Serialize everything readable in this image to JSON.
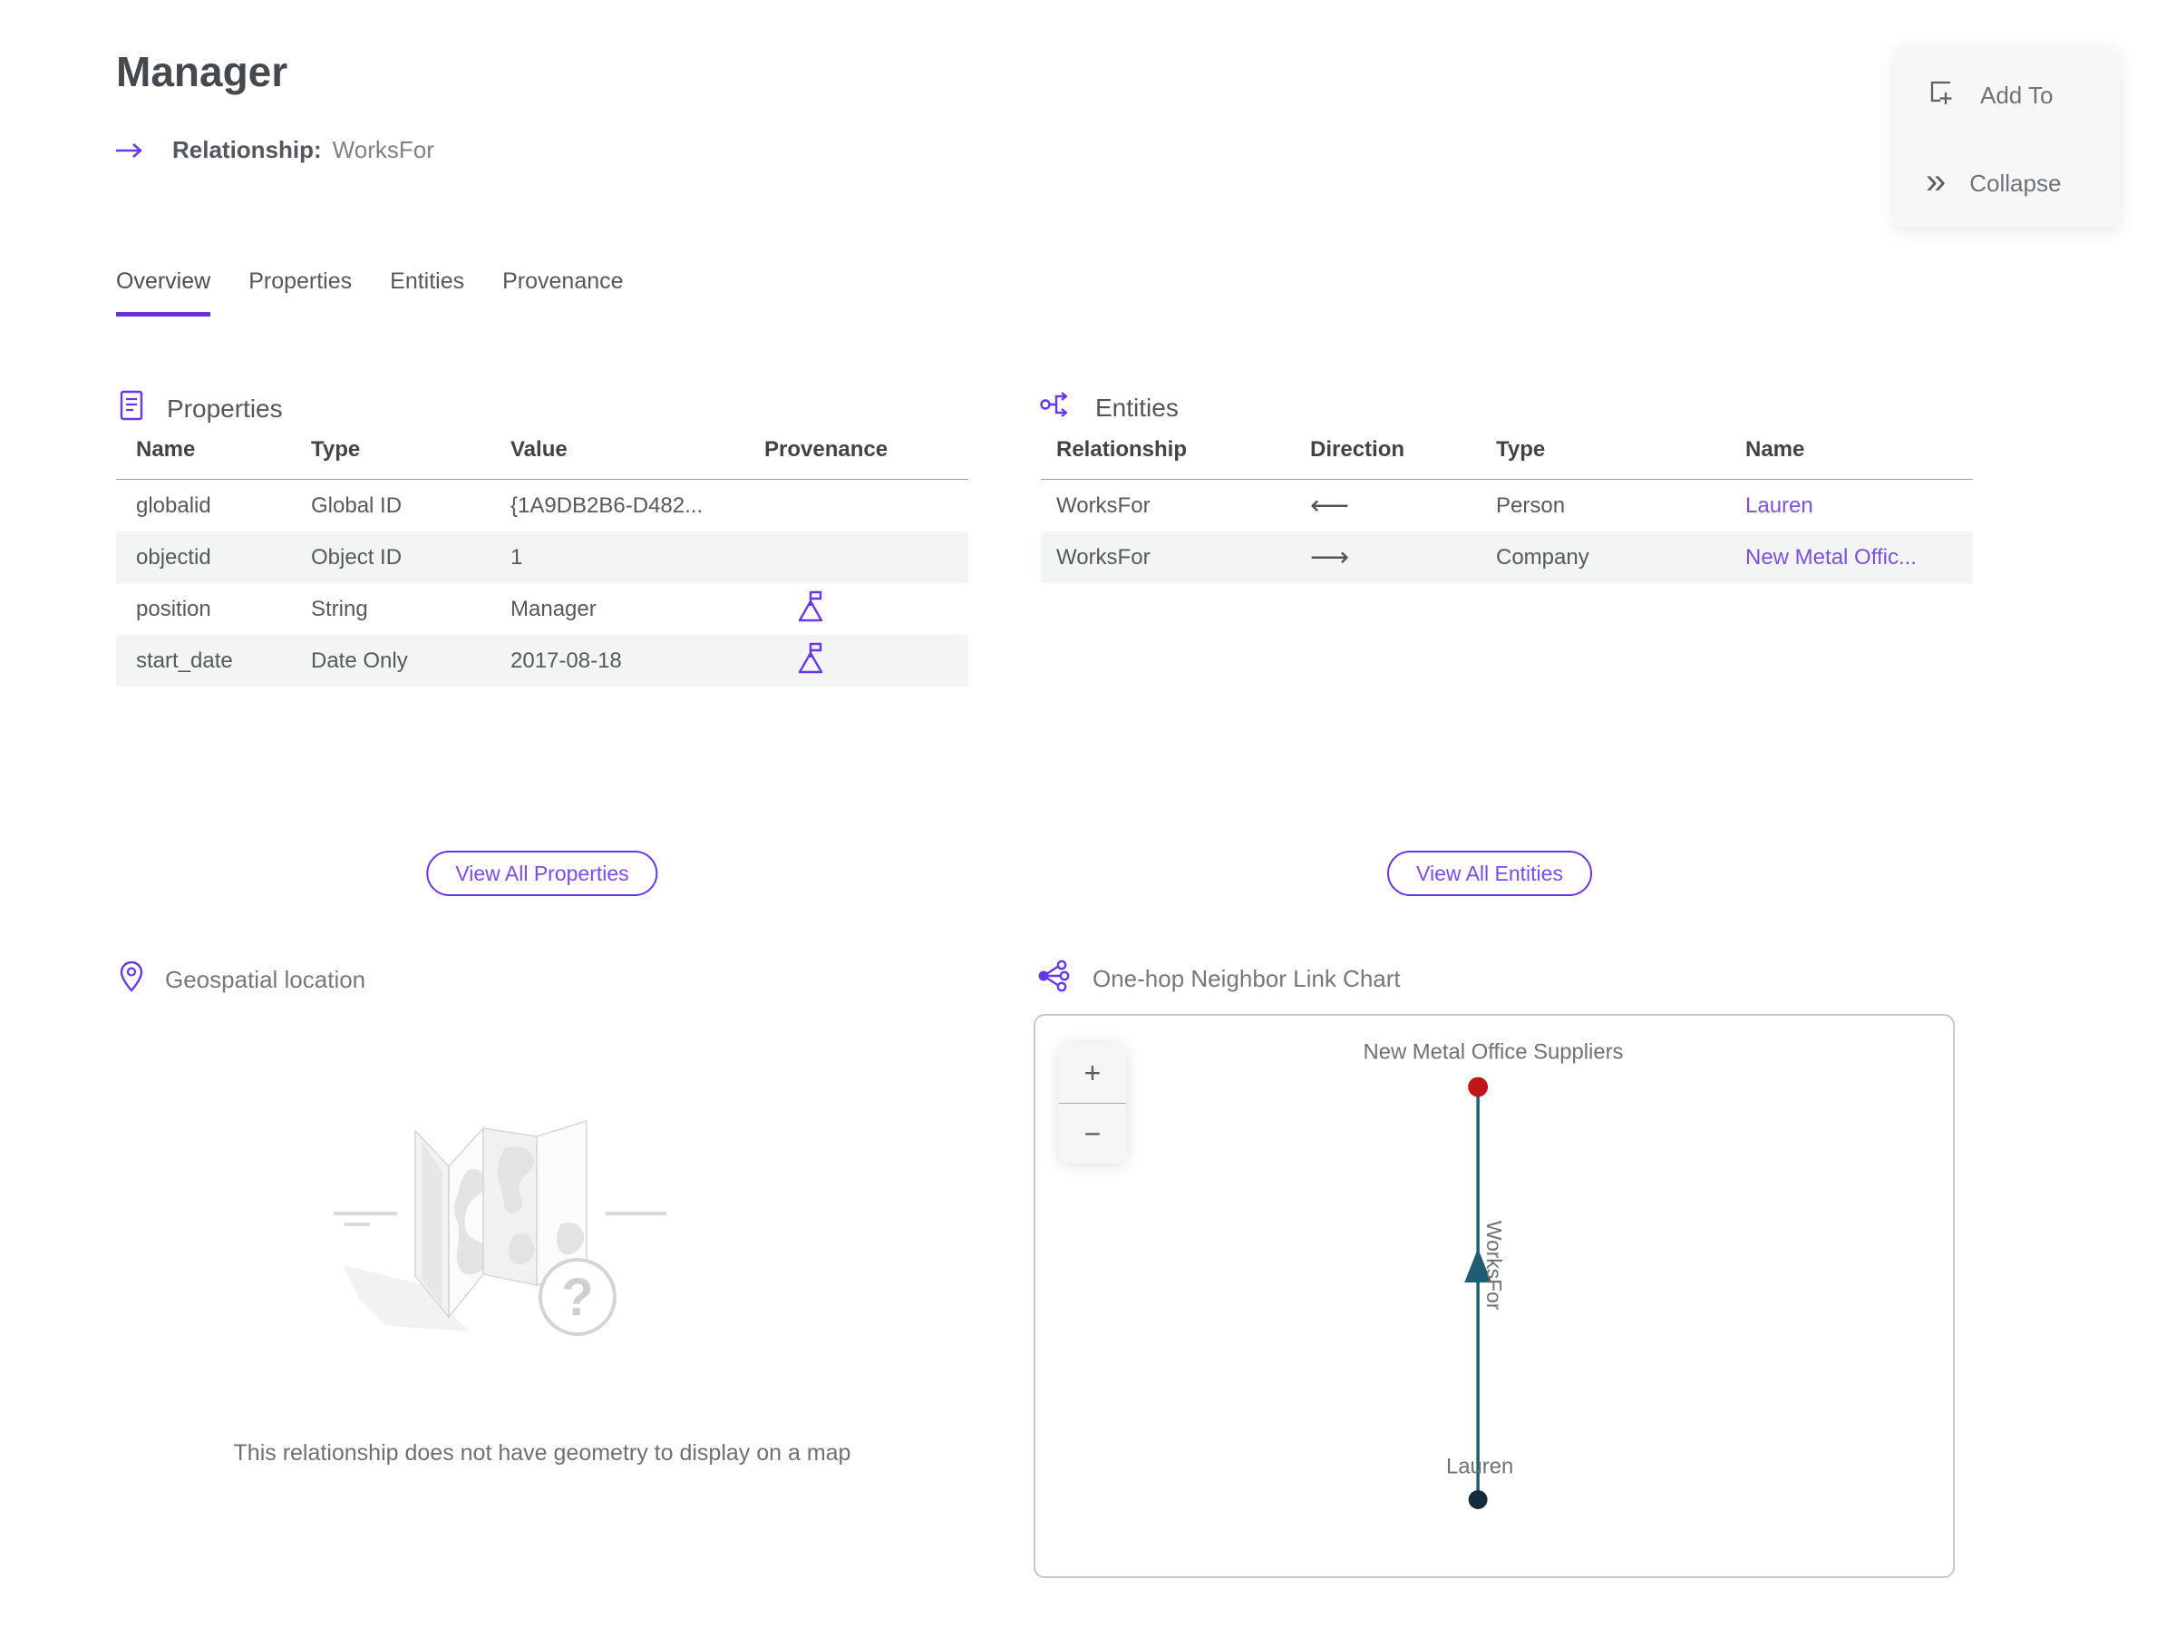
{
  "header": {
    "title": "Manager",
    "relationship_label": "Relationship:",
    "relationship_value": "WorksFor"
  },
  "actions": {
    "add_to": "Add To",
    "collapse": "Collapse"
  },
  "icons": {
    "collapse_glyph": "»",
    "zoom_in": "+",
    "zoom_out": "−",
    "question_mark": "?"
  },
  "tabs": [
    {
      "label": "Overview",
      "active": true
    },
    {
      "label": "Properties",
      "active": false
    },
    {
      "label": "Entities",
      "active": false
    },
    {
      "label": "Provenance",
      "active": false
    }
  ],
  "properties": {
    "title": "Properties",
    "columns": [
      "Name",
      "Type",
      "Value",
      "Provenance"
    ],
    "rows": [
      {
        "name": "globalid",
        "type": "Global ID",
        "value": "{1A9DB2B6-D482...",
        "has_provenance": false
      },
      {
        "name": "objectid",
        "type": "Object ID",
        "value": "1",
        "has_provenance": false
      },
      {
        "name": "position",
        "type": "String",
        "value": "Manager",
        "has_provenance": true
      },
      {
        "name": "start_date",
        "type": "Date Only",
        "value": "2017-08-18",
        "has_provenance": true
      }
    ],
    "view_all": "View All Properties"
  },
  "entities": {
    "title": "Entities",
    "columns": [
      "Relationship",
      "Direction",
      "Type",
      "Name"
    ],
    "rows": [
      {
        "relationship": "WorksFor",
        "direction": "⟵",
        "type": "Person",
        "name": "Lauren"
      },
      {
        "relationship": "WorksFor",
        "direction": "⟶",
        "type": "Company",
        "name": "New Metal Offic..."
      }
    ],
    "view_all": "View All Entities"
  },
  "geospatial": {
    "title": "Geospatial location",
    "empty_message": "This relationship does not have geometry to display on a map"
  },
  "linkchart": {
    "title": "One-hop Neighbor Link Chart",
    "top_node_label": "New Metal Office Suppliers",
    "bottom_node_label": "Lauren",
    "edge_label": "WorksFor"
  },
  "colors": {
    "accent_purple": "#6a35e2",
    "link_purple": "#7a52d9",
    "node_red": "#bf161c",
    "node_navy": "#152a3b",
    "edge_teal": "#1f5e72",
    "tab_underline": "#6b2ee0"
  }
}
